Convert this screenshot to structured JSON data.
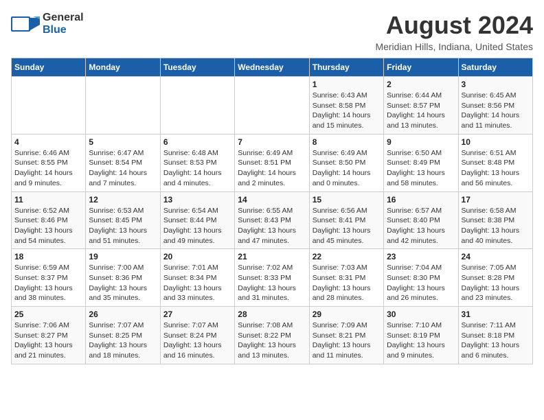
{
  "logo": {
    "line1": "General",
    "line2": "Blue"
  },
  "header": {
    "title": "August 2024",
    "subtitle": "Meridian Hills, Indiana, United States"
  },
  "weekdays": [
    "Sunday",
    "Monday",
    "Tuesday",
    "Wednesday",
    "Thursday",
    "Friday",
    "Saturday"
  ],
  "weeks": [
    [
      {
        "day": "",
        "info": ""
      },
      {
        "day": "",
        "info": ""
      },
      {
        "day": "",
        "info": ""
      },
      {
        "day": "",
        "info": ""
      },
      {
        "day": "1",
        "info": "Sunrise: 6:43 AM\nSunset: 8:58 PM\nDaylight: 14 hours\nand 15 minutes."
      },
      {
        "day": "2",
        "info": "Sunrise: 6:44 AM\nSunset: 8:57 PM\nDaylight: 14 hours\nand 13 minutes."
      },
      {
        "day": "3",
        "info": "Sunrise: 6:45 AM\nSunset: 8:56 PM\nDaylight: 14 hours\nand 11 minutes."
      }
    ],
    [
      {
        "day": "4",
        "info": "Sunrise: 6:46 AM\nSunset: 8:55 PM\nDaylight: 14 hours\nand 9 minutes."
      },
      {
        "day": "5",
        "info": "Sunrise: 6:47 AM\nSunset: 8:54 PM\nDaylight: 14 hours\nand 7 minutes."
      },
      {
        "day": "6",
        "info": "Sunrise: 6:48 AM\nSunset: 8:53 PM\nDaylight: 14 hours\nand 4 minutes."
      },
      {
        "day": "7",
        "info": "Sunrise: 6:49 AM\nSunset: 8:51 PM\nDaylight: 14 hours\nand 2 minutes."
      },
      {
        "day": "8",
        "info": "Sunrise: 6:49 AM\nSunset: 8:50 PM\nDaylight: 14 hours\nand 0 minutes."
      },
      {
        "day": "9",
        "info": "Sunrise: 6:50 AM\nSunset: 8:49 PM\nDaylight: 13 hours\nand 58 minutes."
      },
      {
        "day": "10",
        "info": "Sunrise: 6:51 AM\nSunset: 8:48 PM\nDaylight: 13 hours\nand 56 minutes."
      }
    ],
    [
      {
        "day": "11",
        "info": "Sunrise: 6:52 AM\nSunset: 8:46 PM\nDaylight: 13 hours\nand 54 minutes."
      },
      {
        "day": "12",
        "info": "Sunrise: 6:53 AM\nSunset: 8:45 PM\nDaylight: 13 hours\nand 51 minutes."
      },
      {
        "day": "13",
        "info": "Sunrise: 6:54 AM\nSunset: 8:44 PM\nDaylight: 13 hours\nand 49 minutes."
      },
      {
        "day": "14",
        "info": "Sunrise: 6:55 AM\nSunset: 8:43 PM\nDaylight: 13 hours\nand 47 minutes."
      },
      {
        "day": "15",
        "info": "Sunrise: 6:56 AM\nSunset: 8:41 PM\nDaylight: 13 hours\nand 45 minutes."
      },
      {
        "day": "16",
        "info": "Sunrise: 6:57 AM\nSunset: 8:40 PM\nDaylight: 13 hours\nand 42 minutes."
      },
      {
        "day": "17",
        "info": "Sunrise: 6:58 AM\nSunset: 8:38 PM\nDaylight: 13 hours\nand 40 minutes."
      }
    ],
    [
      {
        "day": "18",
        "info": "Sunrise: 6:59 AM\nSunset: 8:37 PM\nDaylight: 13 hours\nand 38 minutes."
      },
      {
        "day": "19",
        "info": "Sunrise: 7:00 AM\nSunset: 8:36 PM\nDaylight: 13 hours\nand 35 minutes."
      },
      {
        "day": "20",
        "info": "Sunrise: 7:01 AM\nSunset: 8:34 PM\nDaylight: 13 hours\nand 33 minutes."
      },
      {
        "day": "21",
        "info": "Sunrise: 7:02 AM\nSunset: 8:33 PM\nDaylight: 13 hours\nand 31 minutes."
      },
      {
        "day": "22",
        "info": "Sunrise: 7:03 AM\nSunset: 8:31 PM\nDaylight: 13 hours\nand 28 minutes."
      },
      {
        "day": "23",
        "info": "Sunrise: 7:04 AM\nSunset: 8:30 PM\nDaylight: 13 hours\nand 26 minutes."
      },
      {
        "day": "24",
        "info": "Sunrise: 7:05 AM\nSunset: 8:28 PM\nDaylight: 13 hours\nand 23 minutes."
      }
    ],
    [
      {
        "day": "25",
        "info": "Sunrise: 7:06 AM\nSunset: 8:27 PM\nDaylight: 13 hours\nand 21 minutes."
      },
      {
        "day": "26",
        "info": "Sunrise: 7:07 AM\nSunset: 8:25 PM\nDaylight: 13 hours\nand 18 minutes."
      },
      {
        "day": "27",
        "info": "Sunrise: 7:07 AM\nSunset: 8:24 PM\nDaylight: 13 hours\nand 16 minutes."
      },
      {
        "day": "28",
        "info": "Sunrise: 7:08 AM\nSunset: 8:22 PM\nDaylight: 13 hours\nand 13 minutes."
      },
      {
        "day": "29",
        "info": "Sunrise: 7:09 AM\nSunset: 8:21 PM\nDaylight: 13 hours\nand 11 minutes."
      },
      {
        "day": "30",
        "info": "Sunrise: 7:10 AM\nSunset: 8:19 PM\nDaylight: 13 hours\nand 9 minutes."
      },
      {
        "day": "31",
        "info": "Sunrise: 7:11 AM\nSunset: 8:18 PM\nDaylight: 13 hours\nand 6 minutes."
      }
    ]
  ]
}
